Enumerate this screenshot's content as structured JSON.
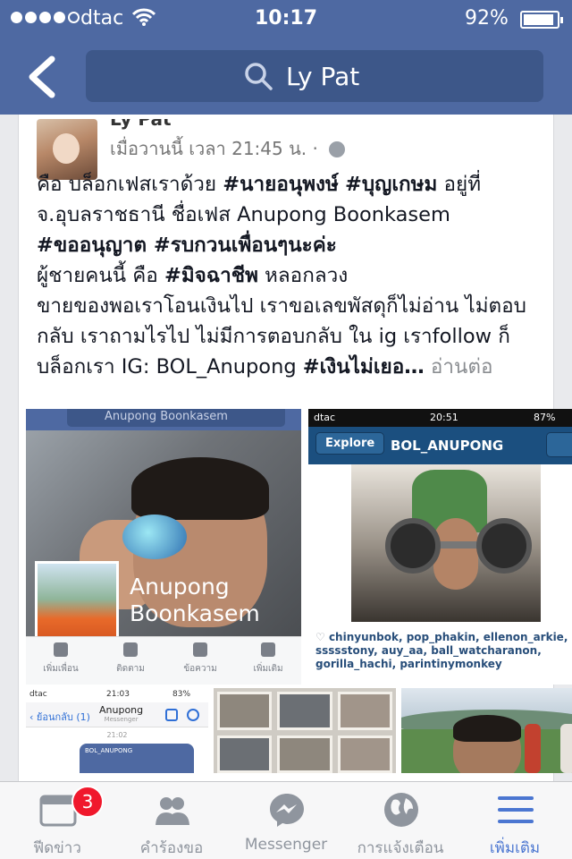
{
  "status_bar": {
    "carrier": "dtac",
    "time": "10:17",
    "battery_percent": "92%",
    "battery_level": 0.92,
    "signal_bars": 4
  },
  "search": {
    "query": "Ly Pat"
  },
  "post": {
    "author_name": "Ly Pat",
    "timestamp": "เมื่อวานนี้ เวลา 21:45 น. ·",
    "text_lines": [
      [
        "คือ บล็อกเฟสเราด้วย ",
        "#นายอนุพงษ์",
        "  ",
        "#บุญเกษม",
        "  อยู่ที่"
      ],
      [
        "จ.อุบลราชธานี     ชื่อเฟส Anupong  Boonkasem"
      ],
      [
        "#ขออนุญาต #รบกวนเพื่อนๆนะค่ะ"
      ],
      [
        "ผู้ชายคนนี้ คือ ",
        "#มิจฉาชีพ",
        " หลอกลวง"
      ],
      [
        "ขายของพอเราโอนเงินไป เราขอเลขพัสดุก็ไม่อ่าน ไม่ตอบ"
      ],
      [
        "กลับ เราถามไรไป ไม่มีการตอบกลับ ใน ig เราfollow ก็"
      ],
      [
        "บล็อกเรา IG: BOL_Anupong ",
        "#เงินไม่เยอ…",
        " "
      ]
    ],
    "see_more": "อ่านต่อ"
  },
  "photo1": {
    "search_text": "Anupong Boonkasem",
    "profile_name_line1": "Anupong",
    "profile_name_line2": "Boonkasem",
    "actions": [
      "เพิ่มเพื่อน",
      "ติดตาม",
      "ข้อความ",
      "เพิ่มเติม"
    ]
  },
  "photo2": {
    "carrier": "dtac",
    "time": "20:51",
    "battery": "87%",
    "back_label": "Explore",
    "username": "BOL_ANUPONG",
    "likes": "chinyunbok, pop_phakin, ellenon_arkie, ssssstony, auy_aa, ball_watcharanon, gorilla_hachi, parintinymonkey"
  },
  "photo3": {
    "carrier": "dtac",
    "time": "21:03",
    "battery": "83%",
    "back_label": "ย้อนกลับ (1)",
    "contact": "Anupong",
    "contact_sub": "Messenger",
    "msg_time": "21:02",
    "bubble_text": "BOL_ANUPONG"
  },
  "tabs": [
    {
      "label": "ฟีดข่าว",
      "icon": "news-feed-icon",
      "badge": "3"
    },
    {
      "label": "คำร้องขอ",
      "icon": "friend-requests-icon"
    },
    {
      "label": "Messenger",
      "icon": "messenger-icon"
    },
    {
      "label": "การแจ้งเตือน",
      "icon": "notifications-globe-icon"
    },
    {
      "label": "เพิ่มเติม",
      "icon": "more-menu-icon",
      "active": true
    }
  ],
  "colors": {
    "header": "#4e69a2",
    "search_box": "#3d5789",
    "active_tab": "#4b76d1",
    "badge": "#f0182c"
  }
}
